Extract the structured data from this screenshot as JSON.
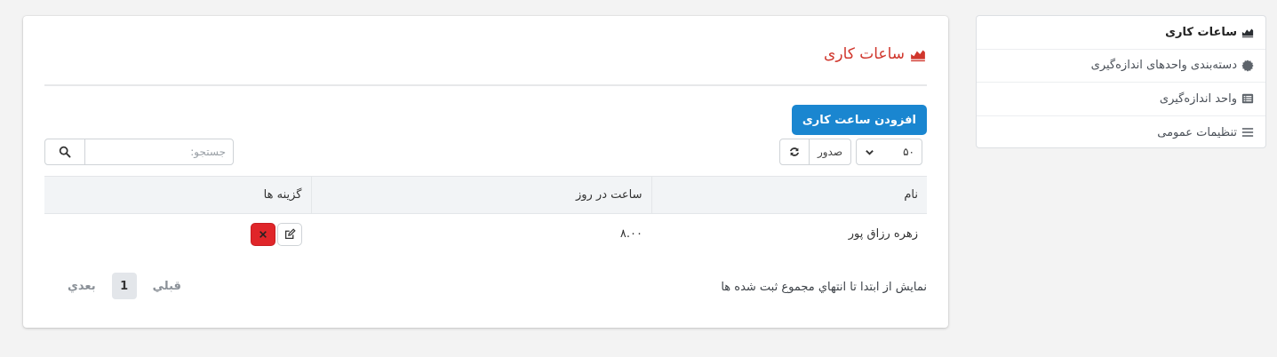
{
  "sidebar": {
    "items": [
      {
        "label": "ساعات کاری",
        "icon": "area-chart-icon",
        "active": true
      },
      {
        "label": "دسته‌بندی واحدهای اندازه‌گیری",
        "icon": "gear-badge-icon"
      },
      {
        "label": "واحد اندازه‌گیری",
        "icon": "list-alt-icon"
      },
      {
        "label": "تنظیمات عمومی",
        "icon": "bars-icon"
      }
    ]
  },
  "main": {
    "title": "ساعات کاری",
    "title_icon": "area-chart-icon",
    "add_button": "افزودن ساعت کاری",
    "page_size": "۵۰",
    "export_label": "صدور",
    "search_placeholder": "جستجو:",
    "table": {
      "headers": [
        "نام",
        "ساعت در روز",
        "گزینه ها"
      ],
      "rows": [
        {
          "name": "زهره رزاق پور",
          "hours": "۸.۰۰"
        }
      ]
    },
    "footer_info": "نمایش از ابتدا تا انتهاي مجموع ثبت شده ها",
    "pagination": {
      "prev": "قبلي",
      "current": "1",
      "next": "بعدي"
    }
  },
  "colors": {
    "accent": "#1a86d0",
    "title_red": "#d0362c",
    "danger": "#e0262a",
    "background": "#f3f3f3"
  }
}
